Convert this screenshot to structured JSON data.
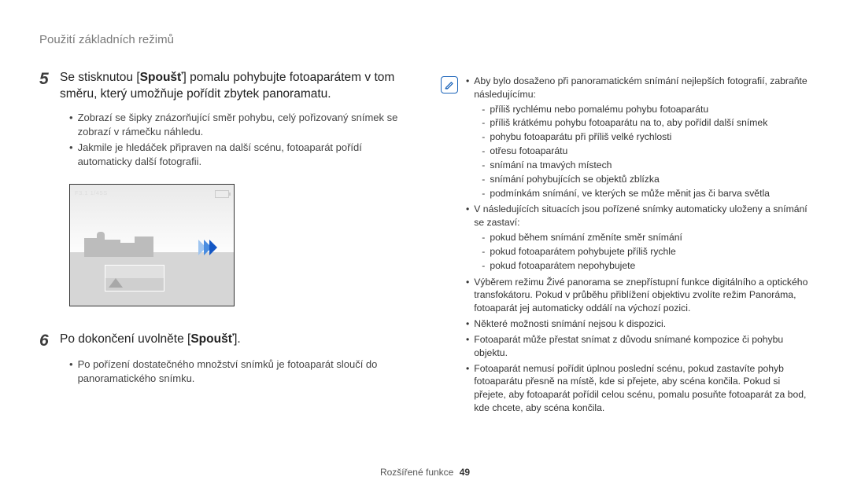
{
  "header": {
    "title": "Použití základních režimů"
  },
  "steps": {
    "s5": {
      "num": "5",
      "text_a": "Se stisknutou [",
      "text_b": "Spoušť",
      "text_c": "] pomalu pohybujte fotoaparátem v tom směru, který umožňuje pořídit zbytek panoramatu.",
      "bullets": [
        "Zobrazí se šipky znázorňující směr pohybu, celý pořizovaný snímek se zobrazí v rámečku náhledu.",
        "Jakmile je hledáček připraven na další scénu, fotoaparát pořídí automaticky další fotografii."
      ]
    },
    "preview_label": "F3.1 1/45S",
    "s6": {
      "num": "6",
      "text_a": "Po dokončení uvolněte [",
      "text_b": "Spoušť",
      "text_c": "].",
      "bullets": [
        "Po pořízení dostatečného množství snímků je fotoaparát sloučí do panoramatického snímku."
      ]
    }
  },
  "note": {
    "icon_name": "note-icon",
    "b1_lead": "Aby bylo dosaženo při panoramatickém snímání nejlepších fotografií, zabraňte následujícímu:",
    "b1_items": [
      "příliš rychlému nebo pomalému pohybu fotoaparátu",
      "příliš krátkému pohybu fotoaparátu na to, aby pořídil další snímek",
      "pohybu fotoaparátu při příliš velké rychlosti",
      "otřesu fotoaparátu",
      "snímání na tmavých místech",
      "snímání pohybujících se objektů zblízka",
      "podmínkám snímání, ve kterých se může měnit jas či barva světla"
    ],
    "b2_lead": "V následujících situacích jsou pořízené snímky automaticky uloženy a snímání se zastaví:",
    "b2_items": [
      "pokud během snímání změníte směr snímání",
      "pokud fotoaparátem pohybujete příliš rychle",
      "pokud fotoaparátem nepohybujete"
    ],
    "b3": "Výběrem režimu Živé panorama se znepřístupní funkce digitálního a optického transfokátoru. Pokud v průběhu přiblížení objektivu zvolíte režim Panoráma, fotoaparát jej automaticky oddálí na výchozí pozici.",
    "b4": "Některé možnosti snímání nejsou k dispozici.",
    "b5": "Fotoaparát může přestat snímat z důvodu snímané kompozice či pohybu objektu.",
    "b6": "Fotoaparát nemusí pořídit úplnou poslední scénu, pokud zastavíte pohyb fotoaparátu přesně na místě, kde si přejete, aby scéna končila. Pokud si přejete, aby fotoaparát pořídil celou scénu, pomalu posuňte fotoaparát za bod, kde chcete, aby scéna končila."
  },
  "footer": {
    "section": "Rozšířené funkce",
    "page": "49"
  }
}
